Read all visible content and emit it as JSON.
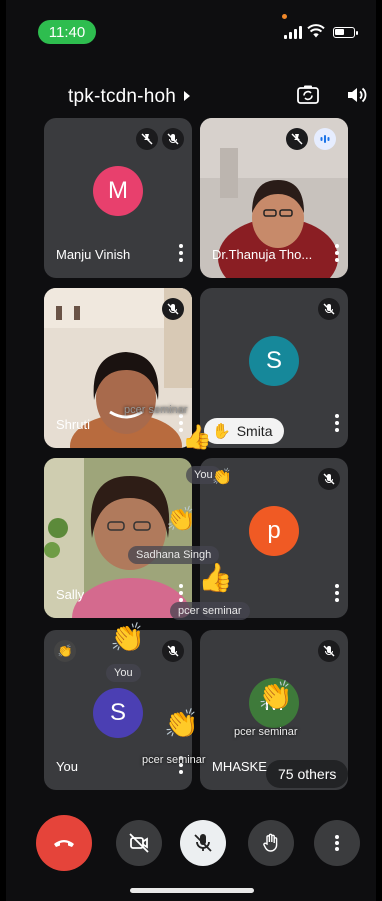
{
  "status_bar": {
    "time": "11:40"
  },
  "header": {
    "meeting_code": "tpk-tcdn-hoh"
  },
  "tiles": [
    {
      "name": "Manju Vinish",
      "avatar_letter": "M",
      "avatar_color": "#e8406d"
    },
    {
      "name": "Dr.Thanuja Tho..."
    },
    {
      "name": "Shruti"
    },
    {
      "name": "",
      "avatar_letter": "S",
      "avatar_color": "#16889a"
    },
    {
      "name": "Sally"
    },
    {
      "name": "",
      "avatar_letter": "p",
      "avatar_color": "#f05a24"
    },
    {
      "name": "You",
      "avatar_letter": "S",
      "avatar_color": "#4b3fb3"
    },
    {
      "name": "MHASKE",
      "avatar_letter": "M",
      "avatar_color": "#3e7a3a"
    }
  ],
  "overlays": {
    "raised_hand_chip": "Smita",
    "pcer_label_1": "pcer seminar",
    "you_label_1": "You",
    "sadhana_label": "Sadhana Singh",
    "pcer_label_2": "pcer seminar",
    "you_label_2": "You",
    "pcer_label_3": "pcer seminar",
    "pcer_label_4": "pcer seminar",
    "others_count": "75 others"
  },
  "icons": {
    "hangup": "phone-hangup-icon",
    "camera": "camera-off-icon",
    "mic": "mic-off-icon",
    "hand": "raise-hand-icon",
    "more": "more-vert-icon"
  }
}
